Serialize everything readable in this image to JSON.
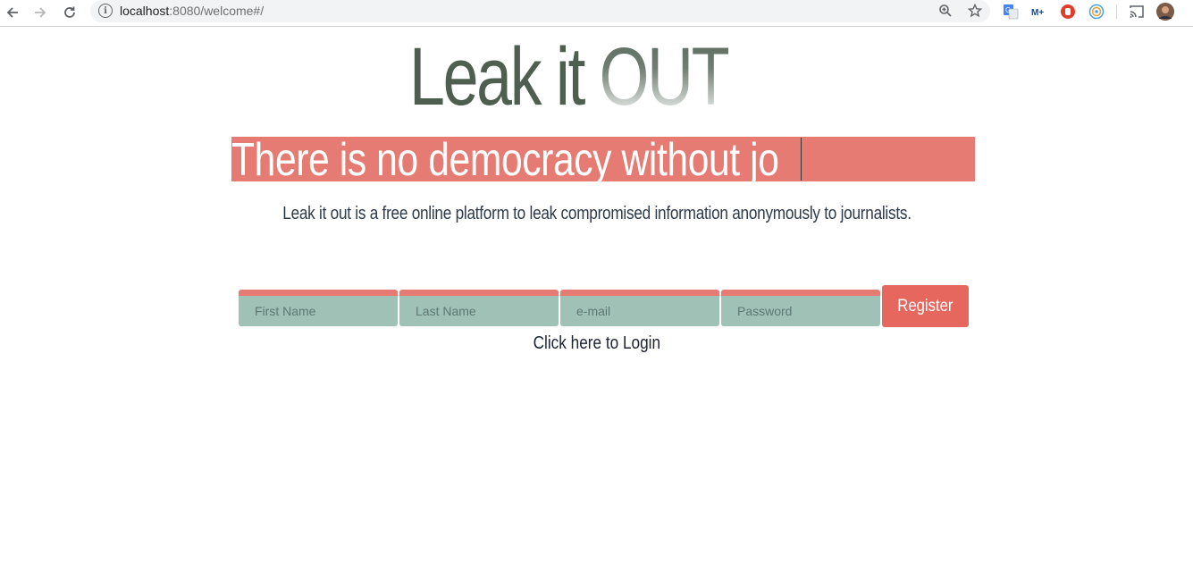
{
  "browser": {
    "url_host": "localhost",
    "url_rest": ":8080/welcome#/",
    "icons": [
      "back-icon",
      "forward-icon",
      "reload-icon",
      "info-icon",
      "zoom-icon",
      "star-icon",
      "translate-extension-icon",
      "movistar-extension-icon",
      "adblock-extension-icon",
      "target-extension-icon",
      "cast-icon",
      "profile-avatar"
    ]
  },
  "page": {
    "logo_main": "Leak it ",
    "logo_out": "OUT",
    "banner_text": "There is no democracy without jo",
    "tagline": "Leak it out is a free online platform to leak compromised information anonymously to journalists.",
    "form": {
      "first_name_placeholder": "First Name",
      "last_name_placeholder": "Last Name",
      "email_placeholder": "e-mail",
      "password_placeholder": "Password",
      "register_label": "Register"
    },
    "login_link": "Click here to Login"
  },
  "colors": {
    "banner": "#e57b72",
    "field": "#9fc1b6",
    "register": "#e5675d",
    "logo": "#4e5f50"
  }
}
